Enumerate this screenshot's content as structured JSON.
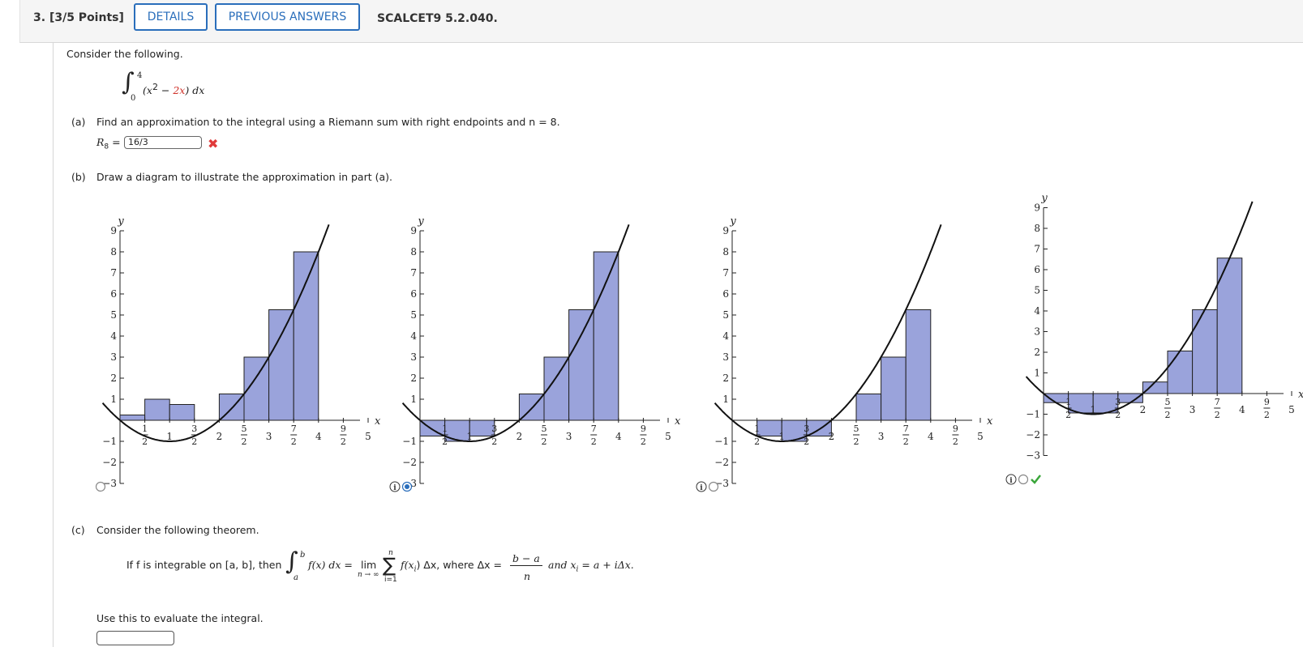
{
  "header": {
    "question_number": "3.",
    "points": "[3/5 Points]",
    "details_label": "DETAILS",
    "previous_answers_label": "PREVIOUS ANSWERS",
    "code": "SCALCET9 5.2.040."
  },
  "intro": "Consider the following.",
  "integral": {
    "lower": "0",
    "upper": "4",
    "integrand_a": "(x",
    "exp": "2",
    "minus": " − ",
    "integrand_b": "2x",
    "integrand_c": ") dx"
  },
  "part_a": {
    "label": "(a)",
    "prompt": "Find an approximation to the integral using a Riemann sum with right endpoints and n = 8.",
    "answer_label": "R",
    "answer_sub": "8",
    "answer_value": "16/3"
  },
  "part_b": {
    "label": "(b)",
    "prompt": "Draw a diagram to illustrate the approximation in part (a)."
  },
  "part_c": {
    "label": "(c)",
    "prompt": "Consider the following theorem.",
    "theorem_prefix": "If f is integrable on [a, b], then",
    "theorem_fx": "f(x) dx =",
    "theorem_lim": "lim",
    "theorem_lim_sub": "n → ∞",
    "theorem_sum_top": "n",
    "theorem_sum_bottom": "i=1",
    "theorem_sum_term": "f(x",
    "theorem_sum_sub": "i",
    "theorem_sum_tail": ") Δx, where Δx =",
    "theorem_frac_num": "b − a",
    "theorem_frac_den": "n",
    "theorem_tail": "and x",
    "theorem_tail_sub": "i",
    "theorem_tail_end": " = a + iΔx.",
    "use_prompt": "Use this to evaluate the integral."
  },
  "graph_labels": {
    "y_axis": "y",
    "x_axis": "x",
    "y_ticks": [
      "9",
      "8",
      "7",
      "6",
      "5",
      "4",
      "3",
      "2",
      "1",
      "−1",
      "−2",
      "−3"
    ],
    "x_ticks": [
      "1/2",
      "1",
      "3/2",
      "2",
      "5/2",
      "3",
      "7/2",
      "4",
      "9/2",
      "5"
    ]
  },
  "chart_data": [
    {
      "type": "bar",
      "title": "",
      "xlabel": "x",
      "ylabel": "y",
      "xlim": [
        0,
        5
      ],
      "ylim": [
        -3,
        9
      ],
      "curve": "y = x^2 - 2x",
      "rect_width": 0.5,
      "rects": [
        [
          0.0,
          0.25
        ],
        [
          0.5,
          1.0
        ],
        [
          1.0,
          0.75
        ],
        [
          2.0,
          1.25
        ],
        [
          2.5,
          3.0
        ],
        [
          3.0,
          5.25
        ],
        [
          3.5,
          8.0
        ]
      ],
      "selected": false,
      "marker": "none"
    },
    {
      "type": "bar",
      "title": "",
      "xlabel": "x",
      "ylabel": "y",
      "xlim": [
        0,
        5
      ],
      "ylim": [
        -3,
        9
      ],
      "curve": "y = x^2 - 2x",
      "rect_width": 0.5,
      "rects": [
        [
          0.0,
          -0.75
        ],
        [
          0.5,
          -1.0
        ],
        [
          1.0,
          -0.75
        ],
        [
          1.5,
          0.0
        ],
        [
          2.0,
          1.25
        ],
        [
          2.5,
          3.0
        ],
        [
          3.0,
          5.25
        ],
        [
          3.5,
          8.0
        ]
      ],
      "selected": true,
      "marker": "none"
    },
    {
      "type": "bar",
      "title": "",
      "xlabel": "x",
      "ylabel": "y",
      "xlim": [
        0,
        5
      ],
      "ylim": [
        -3,
        9
      ],
      "curve": "y = x^2 - 2x",
      "rect_width": 0.5,
      "rects": [
        [
          0.5,
          -0.75
        ],
        [
          1.0,
          -1.0
        ],
        [
          1.5,
          -0.75
        ],
        [
          2.5,
          1.25
        ],
        [
          3.0,
          3.0
        ],
        [
          3.5,
          5.25
        ]
      ],
      "selected": false,
      "marker": "none"
    },
    {
      "type": "bar",
      "title": "",
      "xlabel": "x",
      "ylabel": "y",
      "xlim": [
        0,
        5
      ],
      "ylim": [
        -3,
        9
      ],
      "curve": "y = x^2 - 2x",
      "rect_width": 0.5,
      "rects": [
        [
          0.0,
          -0.44
        ],
        [
          0.5,
          -0.94
        ],
        [
          1.0,
          -0.94
        ],
        [
          1.5,
          -0.44
        ],
        [
          2.0,
          0.56
        ],
        [
          2.5,
          2.06
        ],
        [
          3.0,
          4.06
        ],
        [
          3.5,
          6.56
        ]
      ],
      "selected": false,
      "marker": "check"
    }
  ],
  "colors": {
    "accent": "#2a6ebb",
    "bar_fill": "#9aa3db",
    "wrong": "#e03a3a",
    "correct": "#3aa63a"
  }
}
